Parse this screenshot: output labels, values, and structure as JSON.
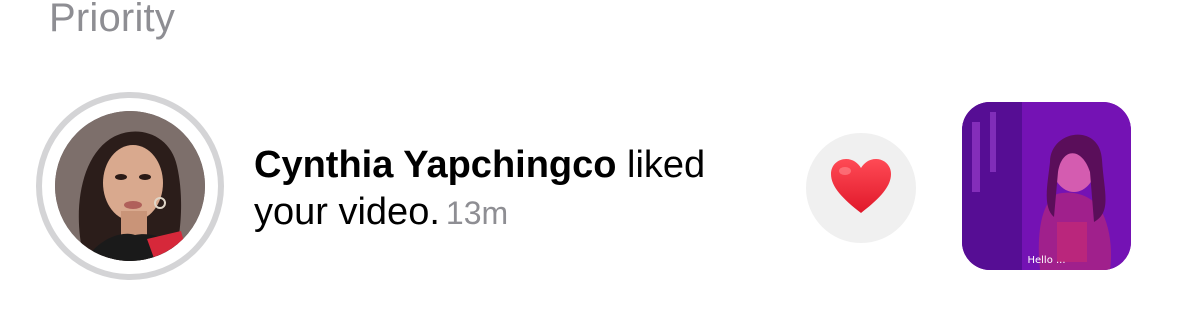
{
  "section": {
    "title": "Priority"
  },
  "notification": {
    "user_name": "Cynthia Yapchingco",
    "action_text": " liked your video.",
    "time_ago": "13m",
    "reaction_icon": "heart-icon",
    "video_caption": "Hello ..."
  },
  "colors": {
    "secondary_text": "#8e8e93",
    "heart": "#ff2d3d",
    "reaction_bg": "#f0f0f0",
    "avatar_ring": "#d4d4d6"
  }
}
